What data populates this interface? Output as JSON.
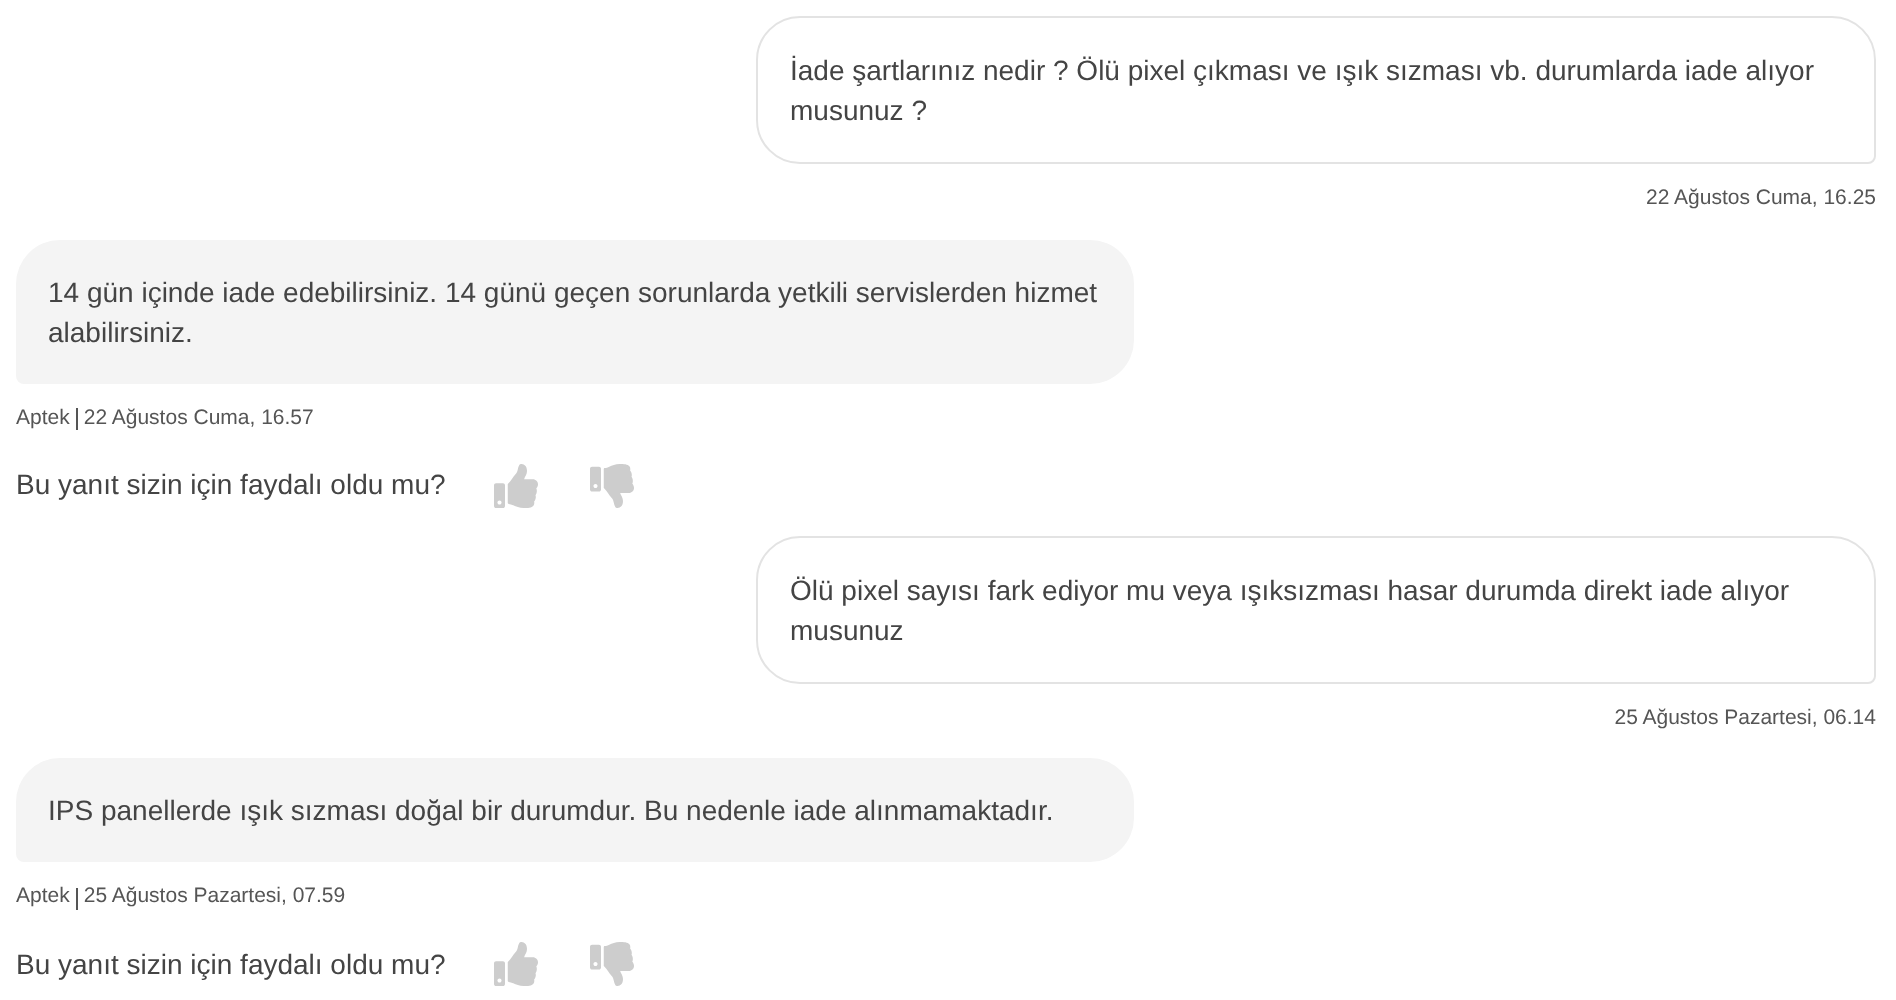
{
  "messages": [
    {
      "kind": "question",
      "text": "İade şartlarınız nedir ? Ölü pixel çıkması ve ışık sızması vb. durumlarda iade alıyor musunuz ?",
      "time": "22 Ağustos Cuma, 16.25"
    },
    {
      "kind": "answer",
      "text": "14 gün içinde iade edebilirsiniz. 14 günü geçen sorunlarda yetkili servislerden hizmet alabilirsiniz.",
      "author": "Aptek",
      "time": "22 Ağustos Cuma, 16.57",
      "feedback": "Bu yanıt sizin için faydalı oldu mu?"
    },
    {
      "kind": "question",
      "text": "Ölü pixel sayısı fark ediyor mu veya ışıksızması hasar durumda direkt iade alıyor musunuz",
      "time": "25 Ağustos Pazartesi, 06.14"
    },
    {
      "kind": "answer",
      "text": "IPS panellerde ışık sızması doğal bir durumdur. Bu nedenle iade alınmamaktadır.",
      "author": "Aptek",
      "time": "25 Ağustos Pazartesi, 07.59",
      "feedback": "Bu yanıt sizin için faydalı oldu mu?"
    }
  ]
}
